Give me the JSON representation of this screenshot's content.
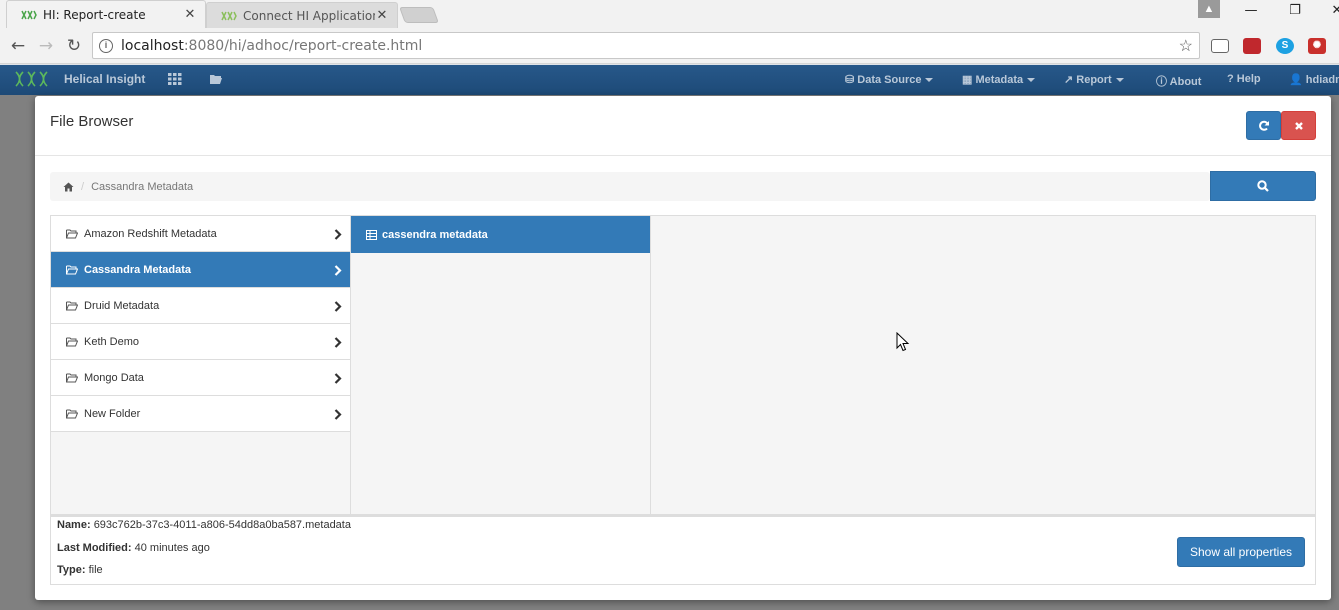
{
  "browser": {
    "tabs": [
      {
        "title": "HI: Report-create"
      },
      {
        "title": "Connect HI Application w"
      }
    ],
    "url_host": "localhost",
    "url_path": ":8080/hi/adhoc/report-create.html"
  },
  "app": {
    "brand": "Helical Insight",
    "nav": {
      "datasource": "Data Source",
      "metadata": "Metadata",
      "report": "Report",
      "about": "About",
      "help": "? Help",
      "user": "hdiadm"
    }
  },
  "modal": {
    "title": "File Browser",
    "breadcrumb": "Cassandra Metadata",
    "folders": [
      {
        "label": "Amazon Redshift Metadata",
        "active": false
      },
      {
        "label": "Cassandra Metadata",
        "active": true
      },
      {
        "label": "Druid Metadata",
        "active": false
      },
      {
        "label": "Keth Demo",
        "active": false
      },
      {
        "label": "Mongo Data",
        "active": false
      },
      {
        "label": "New Folder",
        "active": false
      }
    ],
    "files": [
      {
        "label": "cassendra metadata"
      }
    ],
    "details": {
      "name_label": "Name:",
      "name_value": "693c762b-37c3-4011-a806-54dd8a0ba587.metadata",
      "modified_label": "Last Modified:",
      "modified_value": "40 minutes ago",
      "type_label": "Type:",
      "type_value": "file"
    },
    "show_all_label": "Show all properties"
  },
  "colors": {
    "primary": "#337ab7",
    "danger": "#d9534f",
    "navbar": "#1d4a77"
  }
}
